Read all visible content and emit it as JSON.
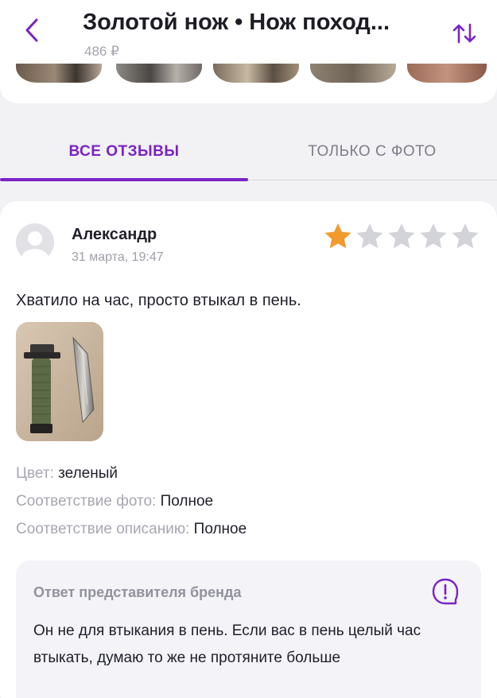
{
  "header": {
    "title": "Золотой нож • Нож поход...",
    "price": "486 ₽"
  },
  "tabs": [
    {
      "label": "ВСЕ ОТЗЫВЫ",
      "active": true
    },
    {
      "label": "ТОЛЬКО С ФОТО",
      "active": false
    }
  ],
  "review": {
    "author": "Александр",
    "date": "31 марта, 19:47",
    "rating": 1,
    "rating_max": 5,
    "text": "Хватило на час, просто втыкал в пень.",
    "attributes": [
      {
        "key": "Цвет:",
        "value": "зеленый"
      },
      {
        "key": "Соответствие фото:",
        "value": "Полное"
      },
      {
        "key": "Соответствие описанию:",
        "value": "Полное"
      }
    ],
    "brand_reply": {
      "title": "Ответ представителя бренда",
      "text": "Он не для втыкания в пень. Если вас в пень целый час втыкать, думаю то же не протяните больше"
    }
  },
  "colors": {
    "accent": "#7a23c4",
    "star_filled": "#f29a2e",
    "star_empty": "#d3d3da"
  }
}
